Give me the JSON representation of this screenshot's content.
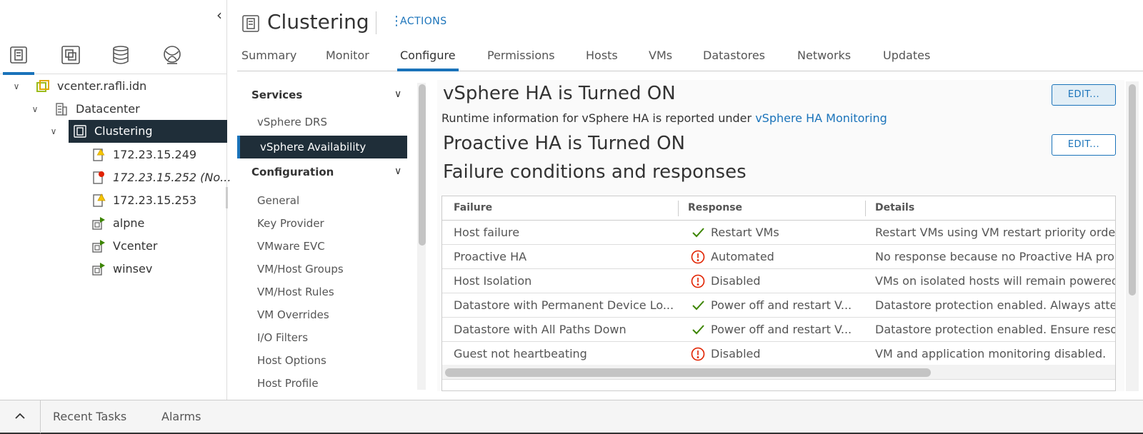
{
  "navigator": {
    "collapse_glyph": "‹",
    "icons": [
      "hosts-and-clusters-icon",
      "vms-and-templates-icon",
      "storage-icon",
      "networking-icon"
    ],
    "tree": [
      {
        "label": "vcenter.rafli.idn",
        "icon": "vcenter-icon",
        "expanded": true
      },
      {
        "label": "Datacenter",
        "icon": "datacenter-icon",
        "expanded": true
      },
      {
        "label": "Clustering",
        "icon": "cluster-icon",
        "expanded": true,
        "selected": true
      },
      {
        "label": "172.23.15.249",
        "icon": "host-warning-icon"
      },
      {
        "label": "172.23.15.252 (No...",
        "icon": "host-error-icon"
      },
      {
        "label": "172.23.15.253",
        "icon": "host-warning-icon"
      },
      {
        "label": "alpne",
        "icon": "vm-running-icon"
      },
      {
        "label": "Vcenter",
        "icon": "vm-running-icon"
      },
      {
        "label": "winsev",
        "icon": "vm-running-icon"
      }
    ]
  },
  "header": {
    "title": "Clustering",
    "actions_label": "ACTIONS",
    "tabs": [
      "Summary",
      "Monitor",
      "Configure",
      "Permissions",
      "Hosts",
      "VMs",
      "Datastores",
      "Networks",
      "Updates"
    ],
    "active_tab": "Configure"
  },
  "subnav": {
    "services_label": "Services",
    "services_items": [
      "vSphere DRS",
      "vSphere Availability"
    ],
    "selected_item": "vSphere Availability",
    "configuration_label": "Configuration",
    "configuration_items": [
      "General",
      "Key Provider",
      "VMware EVC",
      "VM/Host Groups",
      "VM/Host Rules",
      "VM Overrides",
      "I/O Filters",
      "Host Options",
      "Host Profile"
    ]
  },
  "content": {
    "ha_title": "vSphere HA is Turned ON",
    "runtime_text": "Runtime information for vSphere HA is reported under ",
    "runtime_link": "vSphere HA Monitoring",
    "proactive_title": "Proactive HA is Turned ON",
    "failure_title": "Failure conditions and responses",
    "edit_label": "EDIT...",
    "columns": [
      "Failure",
      "Response",
      "Details"
    ],
    "rows": [
      {
        "failure": "Host failure",
        "status": "ok",
        "response": "Restart VMs",
        "details": "Restart VMs using VM restart priority orde"
      },
      {
        "failure": "Proactive HA",
        "status": "warn",
        "response": "Automated",
        "details": "No response because no Proactive HA pro"
      },
      {
        "failure": "Host Isolation",
        "status": "warn",
        "response": "Disabled",
        "details": "VMs on isolated hosts will remain powered"
      },
      {
        "failure": "Datastore with Permanent Device Lo...",
        "status": "ok",
        "response": "Power off and restart V...",
        "details": "Datastore protection enabled. Always atte"
      },
      {
        "failure": "Datastore with All Paths Down",
        "status": "ok",
        "response": "Power off and restart V...",
        "details": "Datastore protection enabled. Ensure reso"
      },
      {
        "failure": "Guest not heartbeating",
        "status": "warn",
        "response": "Disabled",
        "details": "VM and application monitoring disabled."
      }
    ],
    "colors": {
      "ok": "#3c8500",
      "warn": "#e12200",
      "link": "#1a73ba",
      "selected_bg": "#1f2e39"
    }
  },
  "bottom": {
    "expand_glyph": "^",
    "tabs": [
      "Recent Tasks",
      "Alarms"
    ]
  }
}
